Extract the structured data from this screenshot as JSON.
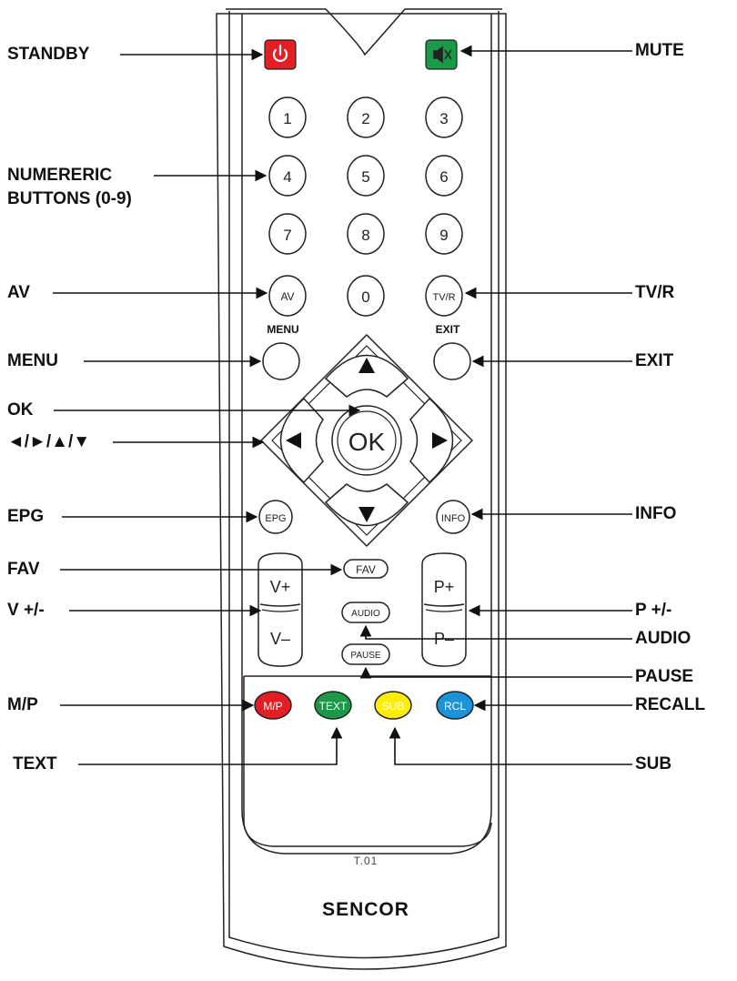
{
  "labels": {
    "standby": "STANDBY",
    "numeric_1": "NUMERERIC",
    "numeric_2": "BUTTONS (0-9)",
    "av": "AV",
    "menu": "MENU",
    "ok": "OK",
    "arrows": "◄/►/▲/▼",
    "epg": "EPG",
    "fav": "FAV",
    "volume": "V +/-",
    "mp": "M/P",
    "text": "TEXT",
    "mute": "MUTE",
    "tvr": "TV/R",
    "exit": "EXIT",
    "info": "INFO",
    "program": "P +/-",
    "audio": "AUDIO",
    "pause": "PAUSE",
    "recall": "RECALL",
    "sub": "SUB"
  },
  "remote": {
    "digits": [
      "1",
      "2",
      "3",
      "4",
      "5",
      "6",
      "7",
      "8",
      "9"
    ],
    "zero": "0",
    "av": "AV",
    "tvr": "TV/R",
    "menu_caption": "MENU",
    "exit_caption": "EXIT",
    "ok": "OK",
    "epg": "EPG",
    "info": "INFO",
    "fav": "FAV",
    "audio": "AUDIO",
    "pause": "PAUSE",
    "v_plus": "V+",
    "v_minus": "V–",
    "p_plus": "P+",
    "p_minus": "P–",
    "mp": "M/P",
    "text": "TEXT",
    "sub": "SUB",
    "rcl": "RCL",
    "model": "T.01",
    "brand": "SENCOR"
  },
  "colors": {
    "standby": "#e31e24",
    "mute": "#1a9a48",
    "mp": "#e31e24",
    "text": "#1a9a48",
    "sub": "#ffed00",
    "rcl": "#1b93d8"
  },
  "icons": {
    "standby": "power-icon",
    "mute": "mute-speaker-icon",
    "up": "triangle-up-icon",
    "down": "triangle-down-icon",
    "left": "triangle-left-icon",
    "right": "triangle-right-icon"
  }
}
